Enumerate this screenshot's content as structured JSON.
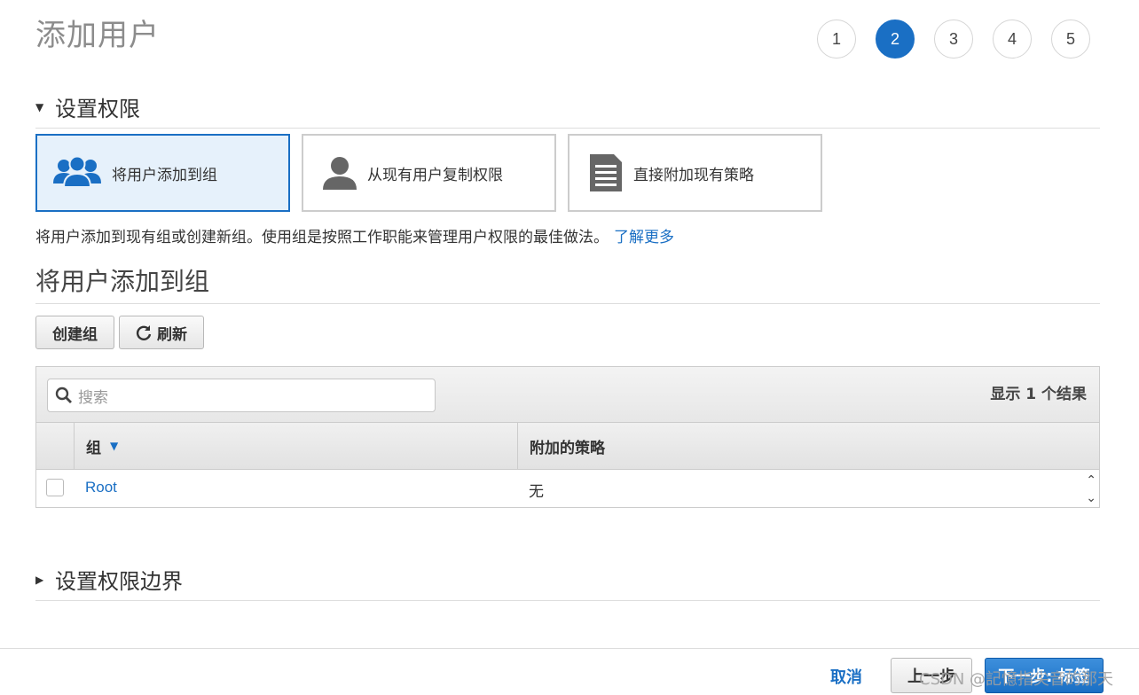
{
  "page": {
    "title": "添加用户"
  },
  "steps": [
    "1",
    "2",
    "3",
    "4",
    "5"
  ],
  "active_step": "2",
  "permissions": {
    "section_title": "设置权限",
    "options": [
      {
        "label": "将用户添加到组",
        "icon": "users-group-icon",
        "selected": true
      },
      {
        "label": "从现有用户复制权限",
        "icon": "user-icon",
        "selected": false
      },
      {
        "label": "直接附加现有策略",
        "icon": "document-icon",
        "selected": false
      }
    ],
    "description": "将用户添加到现有组或创建新组。使用组是按照工作职能来管理用户权限的最佳做法。",
    "learn_more": "了解更多"
  },
  "group_section": {
    "title": "将用户添加到组",
    "create_group_label": "创建组",
    "refresh_label": "刷新",
    "search_placeholder": "搜索",
    "result_count": "显示 1 个结果",
    "columns": [
      "组",
      "附加的策略"
    ],
    "rows": [
      {
        "group": "Root",
        "policy": "无"
      }
    ]
  },
  "boundary_section": {
    "title": "设置权限边界"
  },
  "footer": {
    "cancel_label": "取消",
    "prev_label": "上一步",
    "next_label": "下一步: 标签",
    "watermark": "CSDN @記憶指尖音的那天"
  },
  "colors": {
    "accent": "#1a6fc4",
    "selected_bg": "#e6f1fb"
  }
}
